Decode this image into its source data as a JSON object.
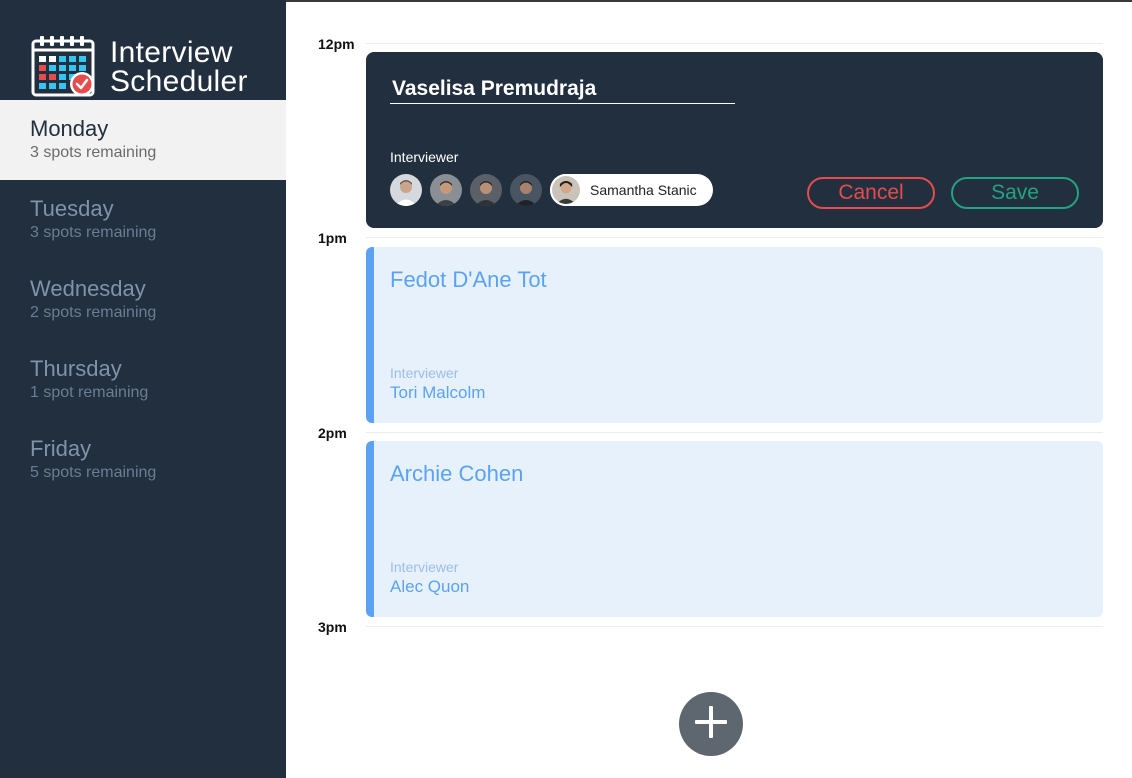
{
  "app": {
    "title_line1": "Interview",
    "title_line2": "Scheduler",
    "logo_icon": "calendar-check-icon"
  },
  "days": [
    {
      "name": "Monday",
      "spots": "3 spots remaining",
      "selected": true
    },
    {
      "name": "Tuesday",
      "spots": "3 spots remaining",
      "selected": false
    },
    {
      "name": "Wednesday",
      "spots": "2 spots remaining",
      "selected": false
    },
    {
      "name": "Thursday",
      "spots": "1 spot remaining",
      "selected": false
    },
    {
      "name": "Friday",
      "spots": "5 spots remaining",
      "selected": false
    }
  ],
  "times": [
    "12pm",
    "1pm",
    "2pm",
    "3pm"
  ],
  "form": {
    "student_name": "Vaselisa Premudraja",
    "interviewer_label": "Interviewer",
    "selected_interviewer": "Samantha Stanic",
    "cancel_label": "Cancel",
    "save_label": "Save"
  },
  "appointments": [
    {
      "student": "Fedot D'Ane Tot",
      "interviewer_label": "Interviewer",
      "interviewer": "Tori Malcolm"
    },
    {
      "student": "Archie Cohen",
      "interviewer_label": "Interviewer",
      "interviewer": "Alec Quon"
    }
  ],
  "add_icon": "plus-icon",
  "colors": {
    "sidebar": "#222f3e",
    "cancel": "#e64c4c",
    "save": "#23a380",
    "appointment_accent": "#5ba3f2",
    "appointment_bg": "#e6f1fc",
    "add_button": "#5e6670"
  }
}
